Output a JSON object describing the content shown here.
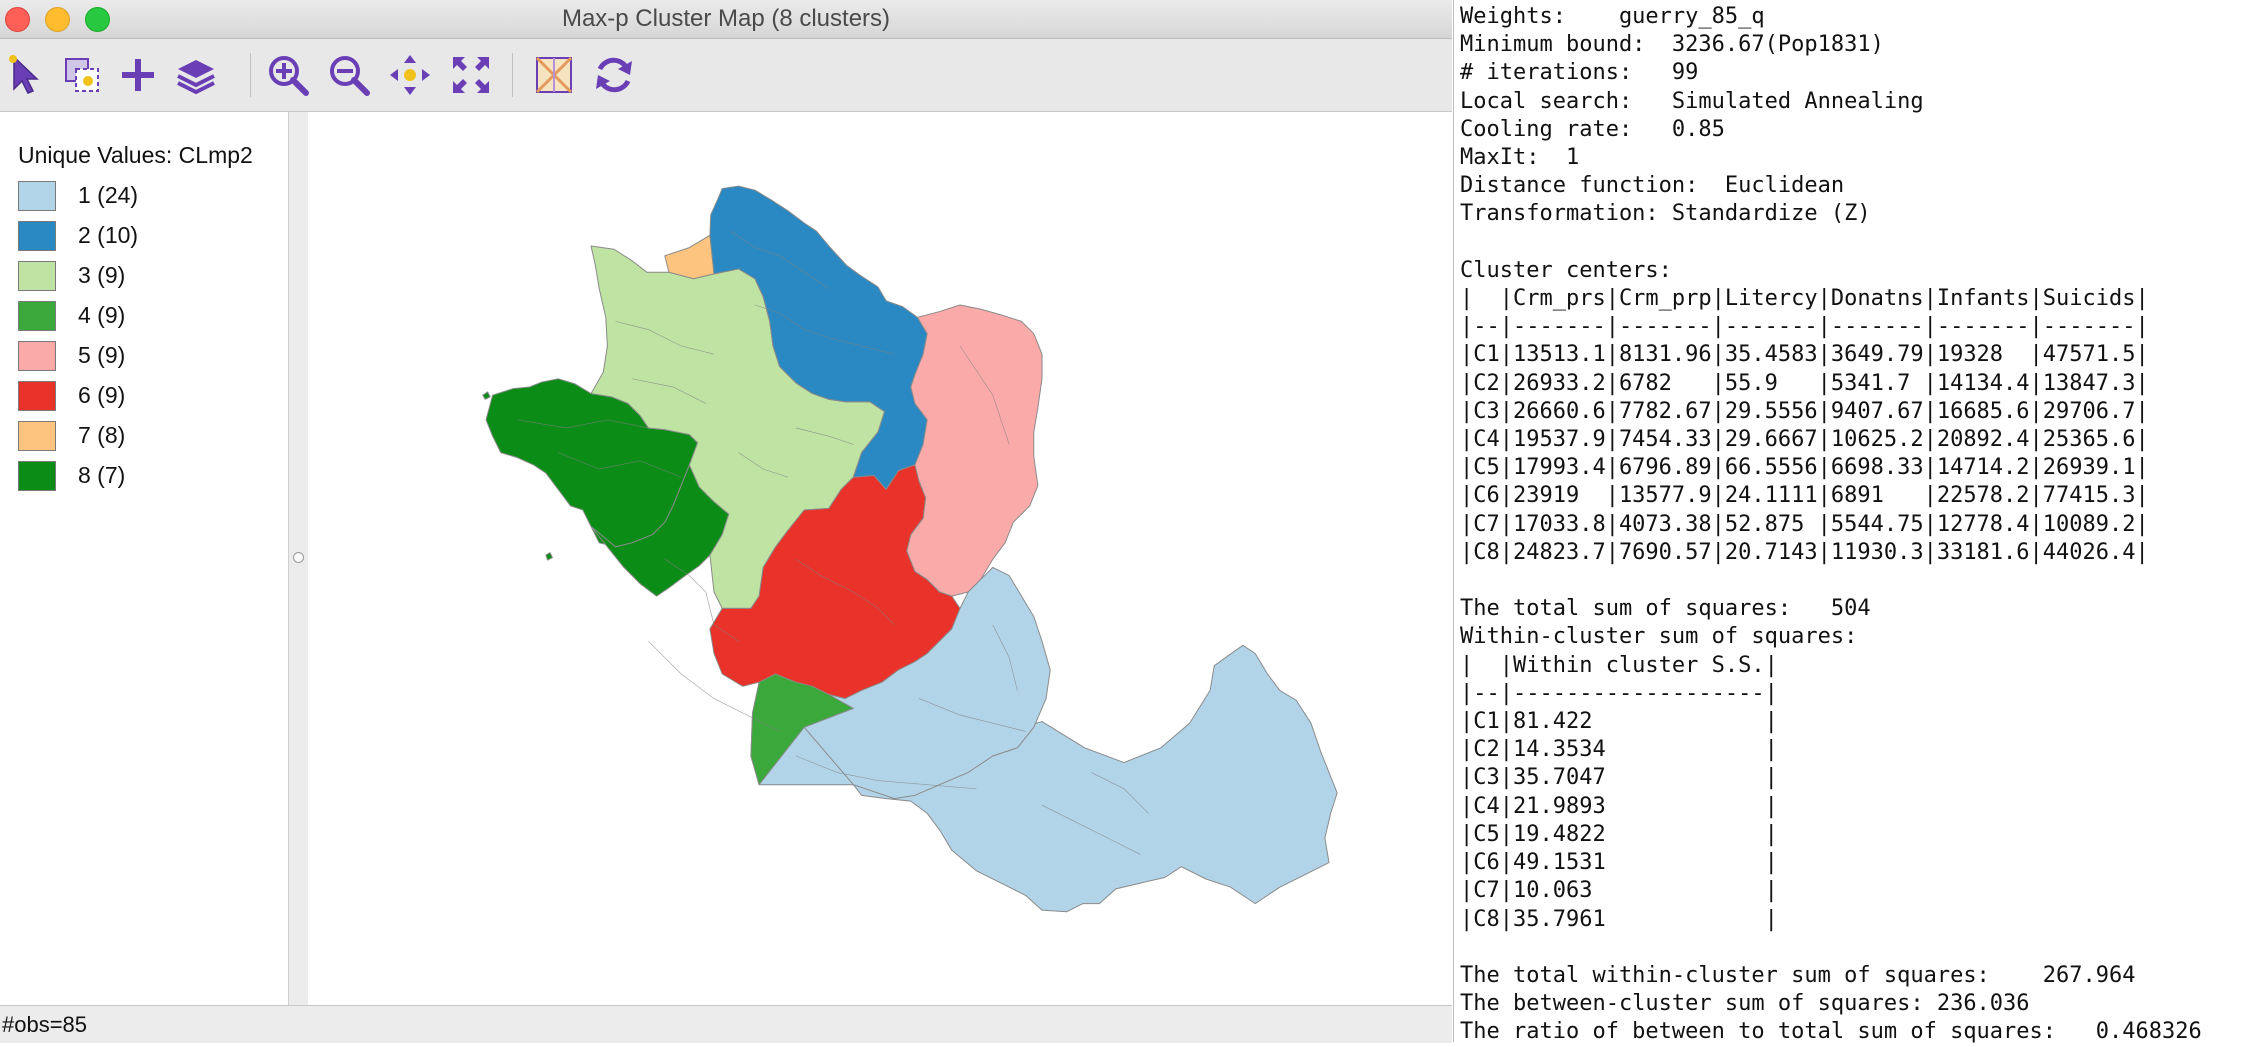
{
  "window": {
    "title": "Max-p Cluster Map (8 clusters)"
  },
  "toolbar": {
    "icons": [
      "select-arrow-icon",
      "select-box-icon",
      "add-icon",
      "layers-icon",
      "zoom-in-icon",
      "zoom-out-icon",
      "pan-icon",
      "full-extent-icon",
      "basemap-icon",
      "refresh-icon"
    ]
  },
  "legend": {
    "title": "Unique Values: CLmp2",
    "items": [
      {
        "label": "1 (24)",
        "color": "#b2d4e8"
      },
      {
        "label": "2 (10)",
        "color": "#2a89c2"
      },
      {
        "label": "3 (9)",
        "color": "#bfe3a3"
      },
      {
        "label": "4 (9)",
        "color": "#3aa83a"
      },
      {
        "label": "5 (9)",
        "color": "#fbaaaa"
      },
      {
        "label": "6 (9)",
        "color": "#e8322a"
      },
      {
        "label": "7 (8)",
        "color": "#fcc47e"
      },
      {
        "label": "8 (7)",
        "color": "#0b8c17"
      }
    ]
  },
  "status": {
    "obs": "#obs=85"
  },
  "report": {
    "lines": [
      "Weights:    guerry_85_q",
      "Minimum bound:  3236.67(Pop1831)",
      "# iterations:   99",
      "Local search:   Simulated Annealing",
      "Cooling rate:   0.85",
      "MaxIt:  1",
      "Distance function:  Euclidean",
      "Transformation: Standardize (Z)",
      "",
      "Cluster centers:",
      "|  |Crm_prs|Crm_prp|Litercy|Donatns|Infants|Suicids|",
      "|--|-------|-------|-------|-------|-------|-------|",
      "|C1|13513.1|8131.96|35.4583|3649.79|19328  |47571.5|",
      "|C2|26933.2|6782   |55.9   |5341.7 |14134.4|13847.3|",
      "|C3|26660.6|7782.67|29.5556|9407.67|16685.6|29706.7|",
      "|C4|19537.9|7454.33|29.6667|10625.2|20892.4|25365.6|",
      "|C5|17993.4|6796.89|66.5556|6698.33|14714.2|26939.1|",
      "|C6|23919  |13577.9|24.1111|6891   |22578.2|77415.3|",
      "|C7|17033.8|4073.38|52.875 |5544.75|12778.4|10089.2|",
      "|C8|24823.7|7690.57|20.7143|11930.3|33181.6|44026.4|",
      "",
      "The total sum of squares:   504",
      "Within-cluster sum of squares:",
      "|  |Within cluster S.S.|",
      "|--|-------------------|",
      "|C1|81.422             |",
      "|C2|14.3534            |",
      "|C3|35.7047            |",
      "|C4|21.9893            |",
      "|C5|19.4822            |",
      "|C6|49.1531            |",
      "|C7|10.063             |",
      "|C8|35.7961            |",
      "",
      "The total within-cluster sum of squares:    267.964",
      "The between-cluster sum of squares: 236.036",
      "The ratio of between to total sum of squares:   0.468326"
    ]
  }
}
